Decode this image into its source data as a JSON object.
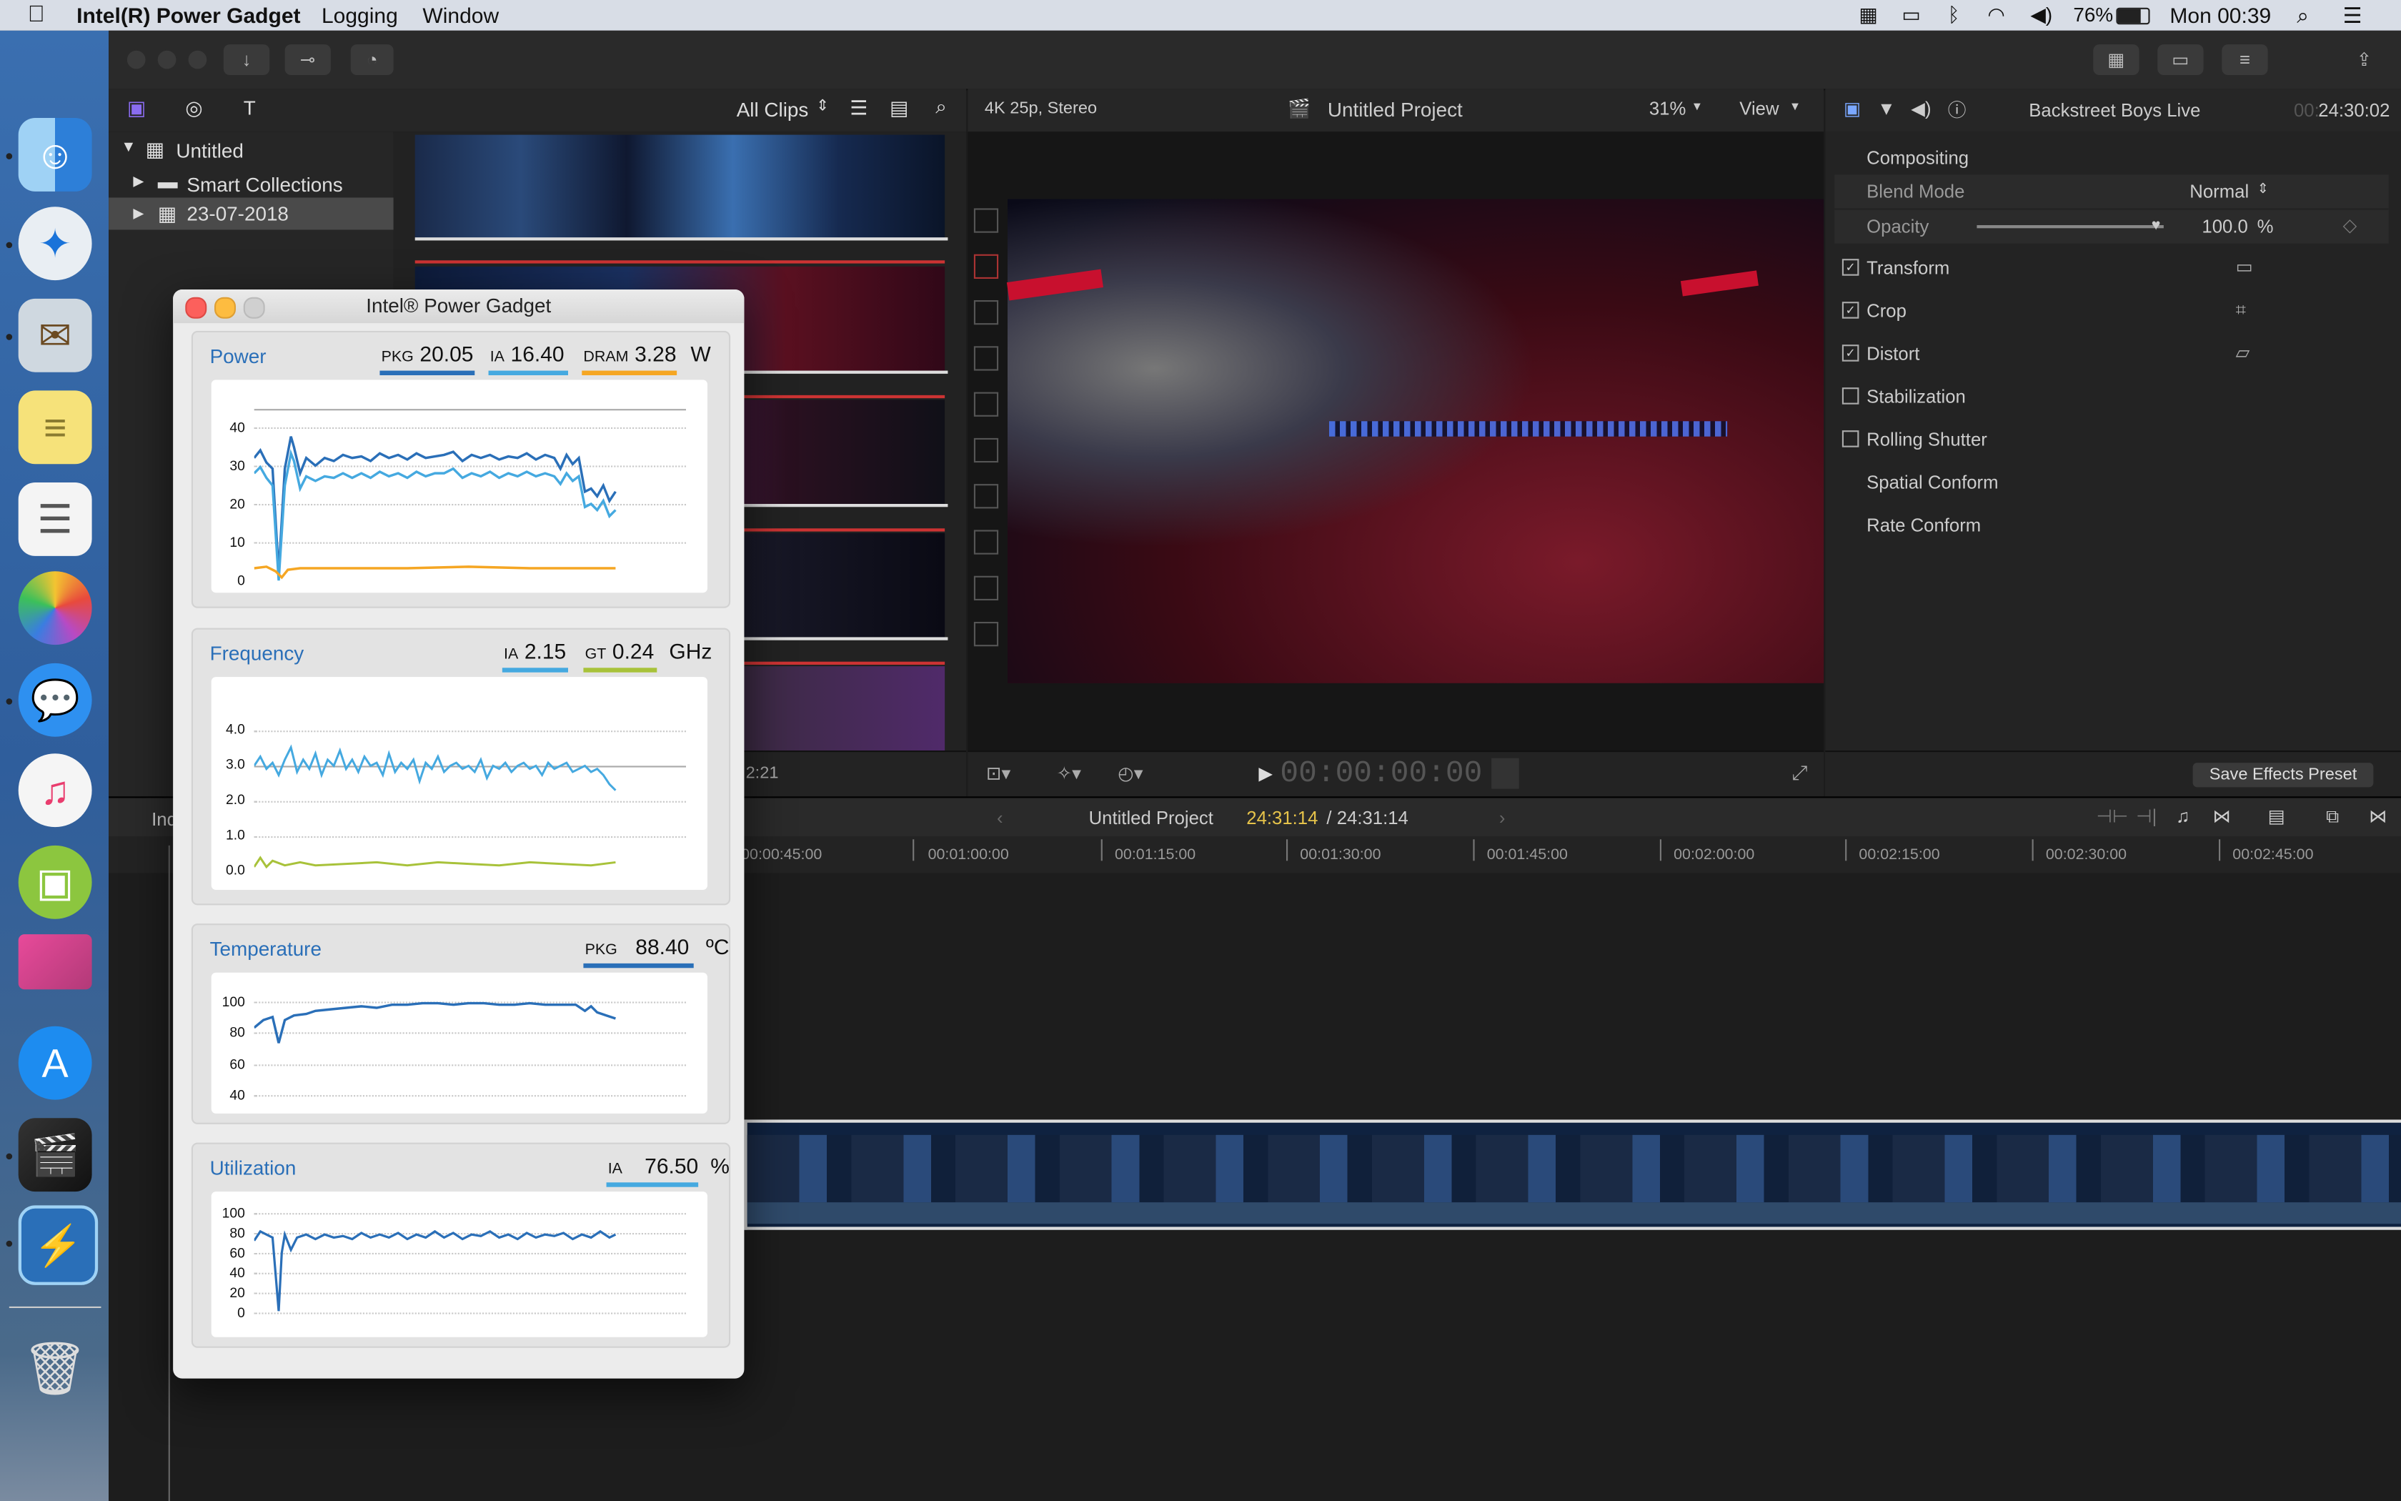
{
  "menubar": {
    "app": "Intel(R) Power Gadget",
    "menus": [
      "Logging",
      "Window"
    ],
    "battery": "76%",
    "clock": "Mon 00:39"
  },
  "library": {
    "filter": "All Clips",
    "items": [
      {
        "label": "Untitled"
      },
      {
        "label": "Smart Collections"
      },
      {
        "label": "23-07-2018"
      }
    ],
    "duration_partial": "2:21"
  },
  "viewer": {
    "format": "4K 25p, Stereo",
    "project": "Untitled Project",
    "zoom": "31%",
    "view": "View",
    "timecode": "00:00:00:00"
  },
  "inspector": {
    "clip_name": "Backstreet Boys Live",
    "timecode_dim": "00:",
    "timecode": "24:30:02",
    "section": "Compositing",
    "blend_mode_label": "Blend Mode",
    "blend_mode_value": "Normal",
    "opacity_label": "Opacity",
    "opacity_value": "100.0",
    "opacity_unit": "%",
    "opacity_level": 1.0,
    "effects": [
      {
        "label": "Transform",
        "checked": true
      },
      {
        "label": "Crop",
        "checked": true
      },
      {
        "label": "Distort",
        "checked": true
      },
      {
        "label": "Stabilization",
        "checked": false
      },
      {
        "label": "Rolling Shutter",
        "checked": false
      },
      {
        "label": "Spatial Conform"
      },
      {
        "label": "Rate Conform"
      }
    ],
    "save_preset": "Save Effects Preset"
  },
  "timeline": {
    "index_label": "Ind",
    "project": "Untitled Project",
    "position": "24:31:14",
    "separator": " / ",
    "duration": "24:31:14",
    "ruler": [
      "00:00:45:00",
      "00:01:00:00",
      "00:01:15:00",
      "00:01:30:00",
      "00:01:45:00",
      "00:02:00:00",
      "00:02:15:00",
      "00:02:30:00",
      "00:02:45:00"
    ]
  },
  "power_gadget": {
    "title": "Intel® Power Gadget",
    "power": {
      "title": "Power",
      "pkg_label": "PKG",
      "pkg": "20.05",
      "ia_label": "IA",
      "ia": "16.40",
      "dram_label": "DRAM",
      "dram": "3.28",
      "unit": "W",
      "ticks": [
        "40",
        "30",
        "20",
        "10",
        "0"
      ]
    },
    "frequency": {
      "title": "Frequency",
      "ia_label": "IA",
      "ia": "2.15",
      "gt_label": "GT",
      "gt": "0.24",
      "unit": "GHz",
      "ticks": [
        "4.0",
        "3.0",
        "2.0",
        "1.0",
        "0.0"
      ]
    },
    "temperature": {
      "title": "Temperature",
      "pkg_label": "PKG",
      "pkg": "88.40",
      "unit": "ºC",
      "ticks": [
        "100",
        "80",
        "60",
        "40"
      ]
    },
    "utilization": {
      "title": "Utilization",
      "ia_label": "IA",
      "ia": "76.50",
      "unit": "%",
      "ticks": [
        "100",
        "80",
        "60",
        "40",
        "20",
        "0"
      ]
    }
  },
  "colors": {
    "pkg": "#2a6fb8",
    "ia": "#45a9e0",
    "dram": "#f5a623",
    "gt": "#a8c23a",
    "accent_timecode": "#e6c34a"
  }
}
